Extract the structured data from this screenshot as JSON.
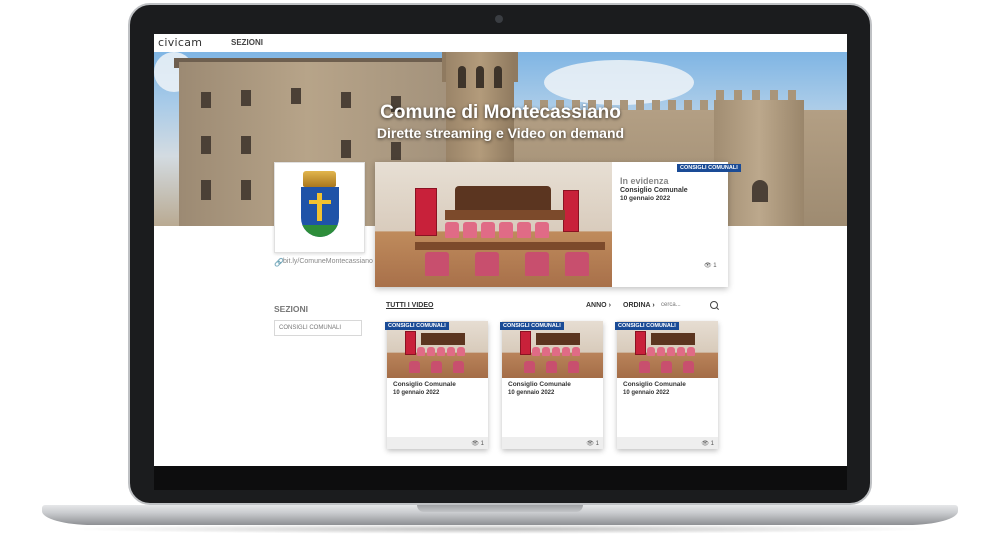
{
  "app": {
    "logo_text": "civicam",
    "nav_item": "SEZIONI"
  },
  "hero": {
    "title": "Comune di Montecassiano",
    "subtitle": "Dirette streaming e Video on demand"
  },
  "profile": {
    "link_text": "bit.ly/ComuneMontecassiano"
  },
  "featured": {
    "badge": "CONSIGLI COMUNALI",
    "label": "In evidenza",
    "title": "Consiglio Comunale",
    "date": "10 gennaio 2022",
    "views": "1"
  },
  "sidebar": {
    "title": "SEZIONI",
    "items": [
      "CONSIGLI COMUNALI"
    ]
  },
  "toolbar": {
    "all_videos": "TUTTI I VIDEO",
    "anno": "ANNO",
    "ordina": "ORDINA",
    "search_placeholder": "cerca..."
  },
  "videos": [
    {
      "badge": "CONSIGLI COMUNALI",
      "title": "Consiglio Comunale",
      "date": "10 gennaio 2022",
      "views": "1"
    },
    {
      "badge": "CONSIGLI COMUNALI",
      "title": "Consiglio Comunale",
      "date": "10 gennaio 2022",
      "views": "1"
    },
    {
      "badge": "CONSIGLI COMUNALI",
      "title": "Consiglio Comunale",
      "date": "10 gennaio 2022",
      "views": "1"
    }
  ],
  "colors": {
    "badge_bg": "#1a4b96",
    "brand_accent": "#1f7fc2"
  },
  "icons": {
    "link": "link-icon",
    "views": "eye-icon",
    "search": "search-icon",
    "chevron": "chevron-right-icon"
  }
}
